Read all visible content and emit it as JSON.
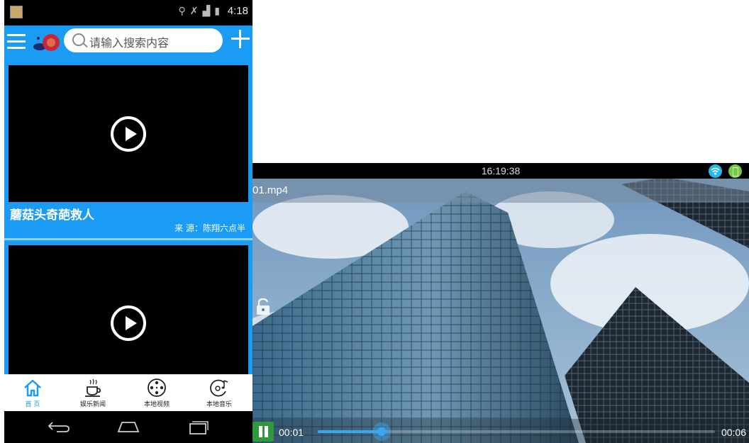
{
  "phone": {
    "status_bar": {
      "time": "4:18",
      "icons": [
        "usb-icon",
        "no-sim-icon",
        "signal-icon",
        "battery-icon"
      ]
    },
    "top_bar": {
      "search_placeholder": "请输入搜索内容",
      "icons": [
        "menu-icon",
        "snail-logo-icon",
        "search-icon",
        "add-icon"
      ]
    },
    "feed": [
      {
        "title": "蘑菇头奇葩救人",
        "source": "来 源：陈翔六点半"
      },
      {
        "title": "",
        "source": ""
      }
    ],
    "bottom_nav": [
      {
        "label": "首 页",
        "icon": "home-icon",
        "active": true
      },
      {
        "label": "娱乐新闻",
        "icon": "coffee-cup-icon",
        "active": false
      },
      {
        "label": "本地视频",
        "icon": "film-reel-icon",
        "active": false
      },
      {
        "label": "本地音乐",
        "icon": "music-disc-icon",
        "active": false
      }
    ],
    "colors": {
      "accent": "#1a9cf5",
      "nav_active": "#1a9cf5"
    }
  },
  "player": {
    "status_bar": {
      "clock": "16:19:38",
      "icons": [
        "wifi-icon",
        "battery-icon"
      ]
    },
    "file_name": "01.mp4",
    "controls": {
      "current_time": "00:01",
      "total_time": "00:06",
      "progress": 0.16,
      "playing": true
    },
    "colors": {
      "seek_fill": "#3aa8f0",
      "pause_button": "#2f9a3c"
    }
  }
}
